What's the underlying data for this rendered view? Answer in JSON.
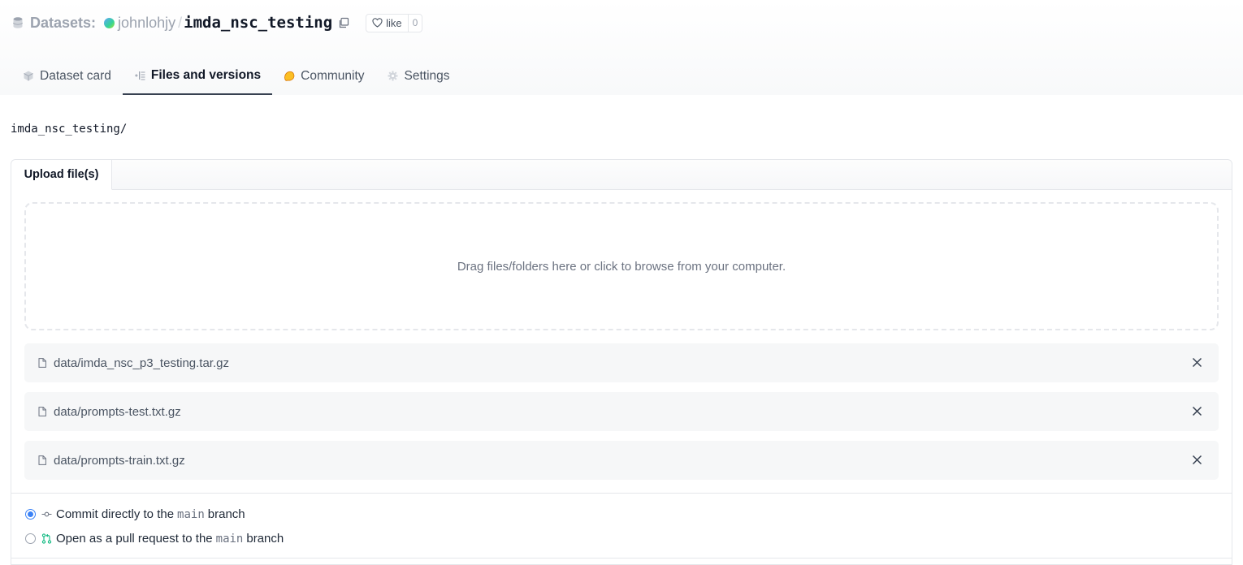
{
  "header": {
    "section_label": "Datasets:",
    "owner": "johnlohjy",
    "separator": "/",
    "repo_name": "imda_nsc_testing",
    "like_label": "like",
    "like_count": "0"
  },
  "tabs": [
    {
      "label": "Dataset card",
      "icon": "dataset-card-icon",
      "active": false
    },
    {
      "label": "Files and versions",
      "icon": "files-icon",
      "active": true
    },
    {
      "label": "Community",
      "icon": "community-icon",
      "active": false
    },
    {
      "label": "Settings",
      "icon": "gear-icon",
      "active": false
    }
  ],
  "path": "imda_nsc_testing/",
  "upload": {
    "tab_label": "Upload file(s)",
    "dropzone_text": "Drag files/folders here or click to browse from your computer.",
    "files": [
      {
        "name": "data/imda_nsc_p3_testing.tar.gz"
      },
      {
        "name": "data/prompts-test.txt.gz"
      },
      {
        "name": "data/prompts-train.txt.gz"
      }
    ]
  },
  "commit": {
    "option_direct_prefix": "Commit directly to the",
    "option_pr_prefix": "Open as a pull request to the",
    "branch": "main",
    "suffix": "branch",
    "selected": "direct"
  },
  "colors": {
    "accent": "#3b82f6",
    "border": "#e5e7eb",
    "community_icon": "#fbbf24"
  }
}
